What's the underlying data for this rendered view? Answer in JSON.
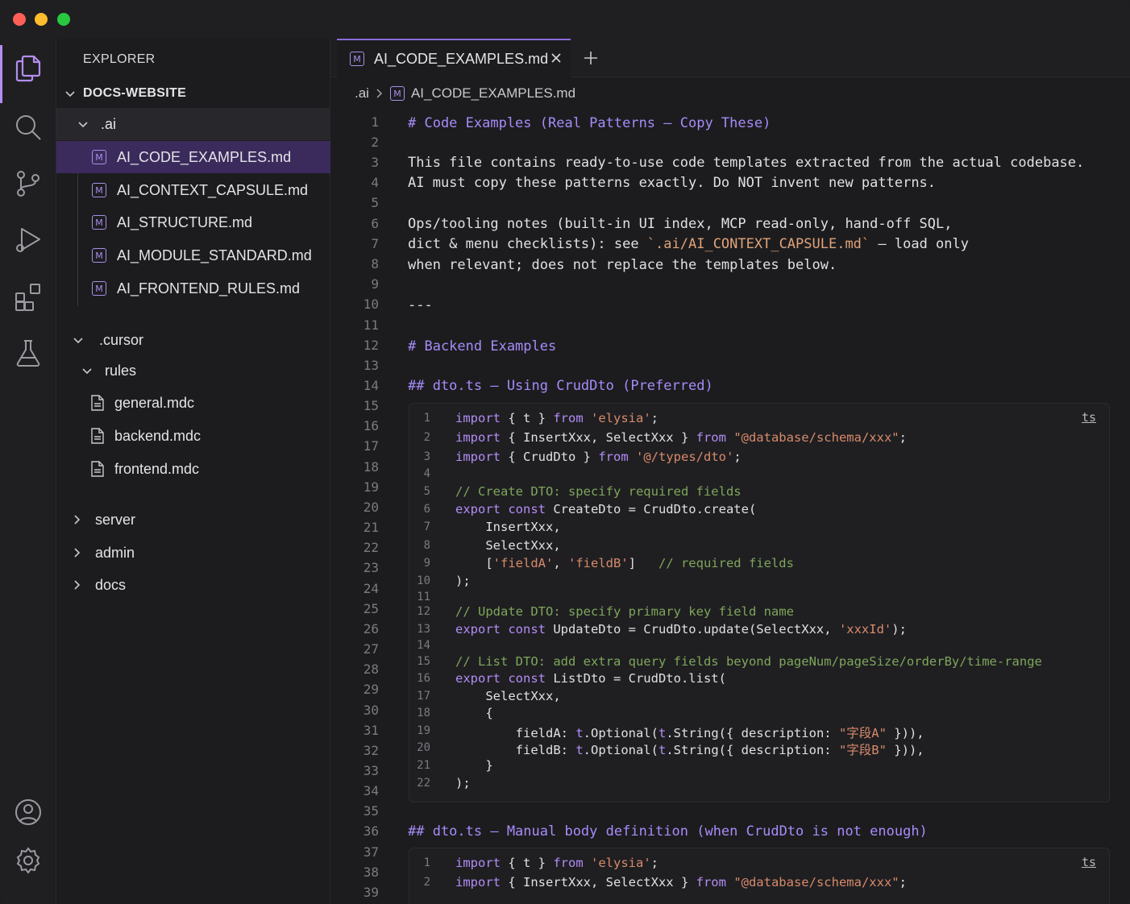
{
  "window": {
    "traffic_lights": [
      "close",
      "minimize",
      "zoom"
    ]
  },
  "activity_bar": {
    "items": [
      "files-icon",
      "search-icon",
      "source-control-icon",
      "run-debug-icon",
      "extensions-icon",
      "testing-icon"
    ],
    "bottom": [
      "account-icon",
      "settings-icon"
    ]
  },
  "sidebar": {
    "title": "EXPLORER",
    "section": "DOCS-WEBSITE",
    "tree": {
      "ai_folder": ".ai",
      "ai_files": [
        "AI_CODE_EXAMPLES.md",
        "AI_CONTEXT_CAPSULE.md",
        "AI_STRUCTURE.md",
        "AI_MODULE_STANDARD.md",
        "AI_FRONTEND_RULES.md"
      ],
      "cursor_folder": ".cursor",
      "rules_folder": "rules",
      "rules_files": [
        "general.mdc",
        "backend.mdc",
        "frontend.mdc"
      ],
      "collapsed": [
        "server",
        "admin",
        "docs"
      ]
    }
  },
  "editor": {
    "tab": {
      "label": "AI_CODE_EXAMPLES.md",
      "icon": "M"
    },
    "breadcrumb": {
      "folder": ".ai",
      "file": "AI_CODE_EXAMPLES.md"
    },
    "line_numbers": [
      "1",
      "2",
      "3",
      "4",
      "5",
      "6",
      "7",
      "8",
      "9",
      "10",
      "11",
      "12",
      "13",
      "14",
      "15",
      "16",
      "17",
      "18",
      "19",
      "20",
      "21",
      "22",
      "23",
      "24",
      "25",
      "26",
      "27",
      "28",
      "29",
      "30",
      "31",
      "32",
      "33",
      "34",
      "35",
      "36",
      "37",
      "38",
      "39"
    ],
    "lines": {
      "l1": "# Code Examples (Real Patterns — Copy These)",
      "l3": "This file contains ready-to-use code templates extracted from the actual codebase.",
      "l4": "AI must copy these patterns exactly. Do NOT invent new patterns.",
      "l6": "Ops/tooling notes (built-in UI index, MCP read-only, hand-off SQL,",
      "l7a": "dict & menu checklists): see ",
      "l7b": "`.ai/AI_CONTEXT_CAPSULE.md`",
      "l7c": " — load only",
      "l8": "when relevant; does not replace the templates below.",
      "l10": "---",
      "l12": "# Backend Examples",
      "l14": "## dto.ts — Using CrudDto (Preferred)",
      "l36": "## dto.ts — Manual body definition (when CrudDto is not enough)"
    },
    "code_block_1": {
      "lang": "ts",
      "line_numbers": [
        "1",
        "2",
        "3",
        "4",
        "5",
        "6",
        "7",
        "8",
        "9",
        "10",
        "11",
        "12",
        "13",
        "14",
        "15",
        "16",
        "17",
        "18",
        "19",
        "20",
        "21",
        "22"
      ]
    },
    "code_block_2": {
      "lang": "ts",
      "line_numbers": [
        "1",
        "2"
      ]
    }
  },
  "colors": {
    "accent": "#8b6bd8",
    "heading": "#a78bfa",
    "keyword": "#b38cf5",
    "string": "#d88a6a",
    "comment": "#7fa65a"
  }
}
